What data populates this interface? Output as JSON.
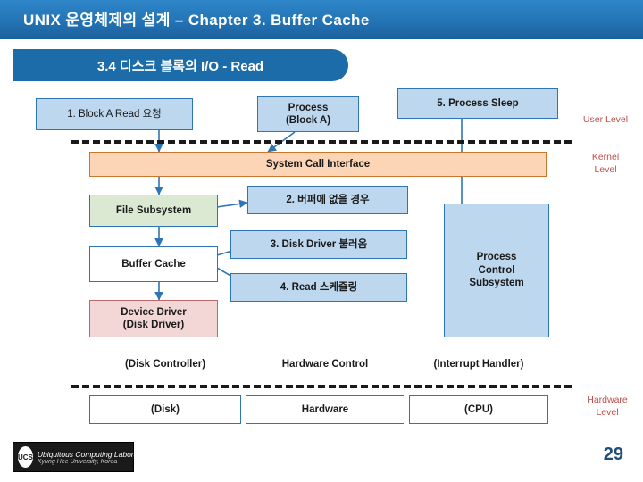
{
  "header": {
    "title": "UNIX 운영체제의 설계 – Chapter 3. Buffer Cache"
  },
  "section": {
    "label": "3.4 디스크 블록의 I/O - Read"
  },
  "diagram": {
    "boxes": [
      {
        "id": "block-a-read-request",
        "label": "1. Block A Read 요청"
      },
      {
        "id": "process-block-a",
        "label": "Process\n(Block A)"
      },
      {
        "id": "process-sleep",
        "label": "5. Process Sleep"
      },
      {
        "id": "system-call-interface",
        "label": "System Call Interface"
      },
      {
        "id": "file-subsystem",
        "label": "File Subsystem"
      },
      {
        "id": "no-buffer-case",
        "label": "2. 버퍼에 없을 경우"
      },
      {
        "id": "disk-driver-call",
        "label": "3. Disk Driver 불러옴"
      },
      {
        "id": "buffer-cache",
        "label": "Buffer Cache"
      },
      {
        "id": "read-schedule",
        "label": "4. Read 스케줄링"
      },
      {
        "id": "device-driver",
        "label": "Device Driver\n(Disk Driver)"
      },
      {
        "id": "process-control-subsystem",
        "label": "Process\nControl\nSubsystem"
      },
      {
        "id": "disk-controller",
        "label": "(Disk Controller)"
      },
      {
        "id": "hardware-control",
        "label": "Hardware Control"
      },
      {
        "id": "interrupt-handler",
        "label": "(Interrupt Handler)"
      },
      {
        "id": "disk",
        "label": "(Disk)"
      },
      {
        "id": "hardware",
        "label": "Hardware"
      },
      {
        "id": "cpu",
        "label": "(CPU)"
      }
    ],
    "levels": [
      {
        "id": "user-level",
        "label": "User Level"
      },
      {
        "id": "kernel-level",
        "label": "Kernel\nLevel"
      },
      {
        "id": "hardware-level",
        "label": "Hardware\nLevel"
      }
    ]
  },
  "footer": {
    "logo_mark": "UCS",
    "logo_line1": "Ubiquitous Computing Laboratory",
    "logo_line2": "Kyung Hee University, Korea",
    "page_number": "29"
  }
}
